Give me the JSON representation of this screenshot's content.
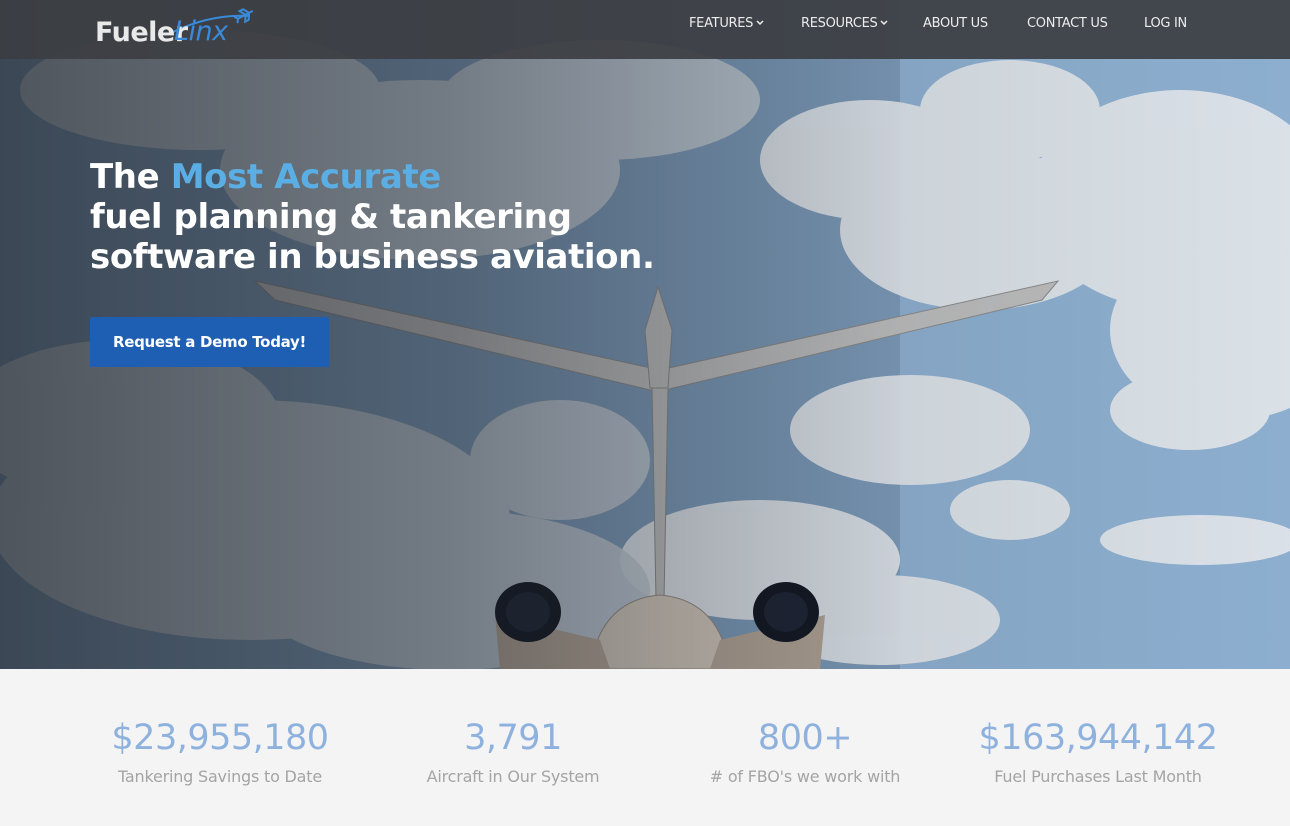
{
  "brand": {
    "name_part1": "Fueler",
    "name_part2": "Linx",
    "accent_color": "#3a8ad8"
  },
  "nav": {
    "items": [
      {
        "label": "FEATURES",
        "has_dropdown": true
      },
      {
        "label": "RESOURCES",
        "has_dropdown": true
      },
      {
        "label": "ABOUT US",
        "has_dropdown": false
      },
      {
        "label": "CONTACT US",
        "has_dropdown": false
      },
      {
        "label": "LOG IN",
        "has_dropdown": false
      }
    ]
  },
  "hero": {
    "headline_prefix": "The ",
    "headline_accent": "Most Accurate",
    "headline_line2": "fuel planning & tankering",
    "headline_line3": "software in business aviation.",
    "cta_label": "Request a Demo Today!",
    "cta_color": "#1e5fb4",
    "accent_color": "#5aaee4"
  },
  "stats": [
    {
      "value": "$23,955,180",
      "label": "Tankering Savings to Date"
    },
    {
      "value": "3,791",
      "label": "Aircraft in Our System"
    },
    {
      "value": "800+",
      "label": "# of FBO's we work with"
    },
    {
      "value": "$163,944,142",
      "label": "Fuel Purchases Last Month"
    }
  ],
  "icons": [
    "airplane-logo-icon",
    "chevron-down-icon"
  ]
}
